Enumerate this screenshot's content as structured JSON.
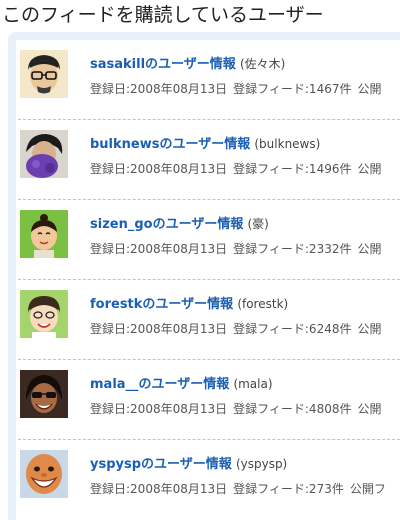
{
  "heading": "このフィードを購読しているユーザー",
  "users": [
    {
      "username": "sasakill",
      "link_suffix": "のユーザー情報",
      "real_name": "(佐々木)",
      "registered": "登録日:2008年08月13日",
      "feeds": "登録フィード:1467件",
      "public": "公開",
      "avatar": "glasses-man-illustration"
    },
    {
      "username": "bulknews",
      "link_suffix": "のユーザー情報",
      "real_name": "(bulknews)",
      "registered": "登録日:2008年08月13日",
      "feeds": "登録フィード:1496件",
      "public": "公開",
      "avatar": "person-with-purple-plush-photo"
    },
    {
      "username": "sizen_go",
      "link_suffix": "のユーザー情報",
      "real_name": "(豪)",
      "registered": "登録日:2008年08月13日",
      "feeds": "登録フィード:2332件",
      "public": "公開",
      "avatar": "topknot-cartoon-on-green"
    },
    {
      "username": "forestk",
      "link_suffix": "のユーザー情報",
      "real_name": "(forestk)",
      "registered": "登録日:2008年08月13日",
      "feeds": "登録フィード:6248件",
      "public": "公開",
      "avatar": "smiling-glasses-cartoon"
    },
    {
      "username": "mala__",
      "link_suffix": "のユーザー情報",
      "real_name": "(mala)",
      "registered": "登録日:2008年08月13日",
      "feeds": "登録フィード:4808件",
      "public": "公開",
      "avatar": "man-with-sunglasses-photo"
    },
    {
      "username": "yspysp",
      "link_suffix": "のユーザー情報",
      "real_name": "(yspysp)",
      "registered": "登録日:2008年08月13日",
      "feeds": "登録フィード:273件",
      "public": "公開フ",
      "avatar": "grinning-bald-character"
    }
  ]
}
